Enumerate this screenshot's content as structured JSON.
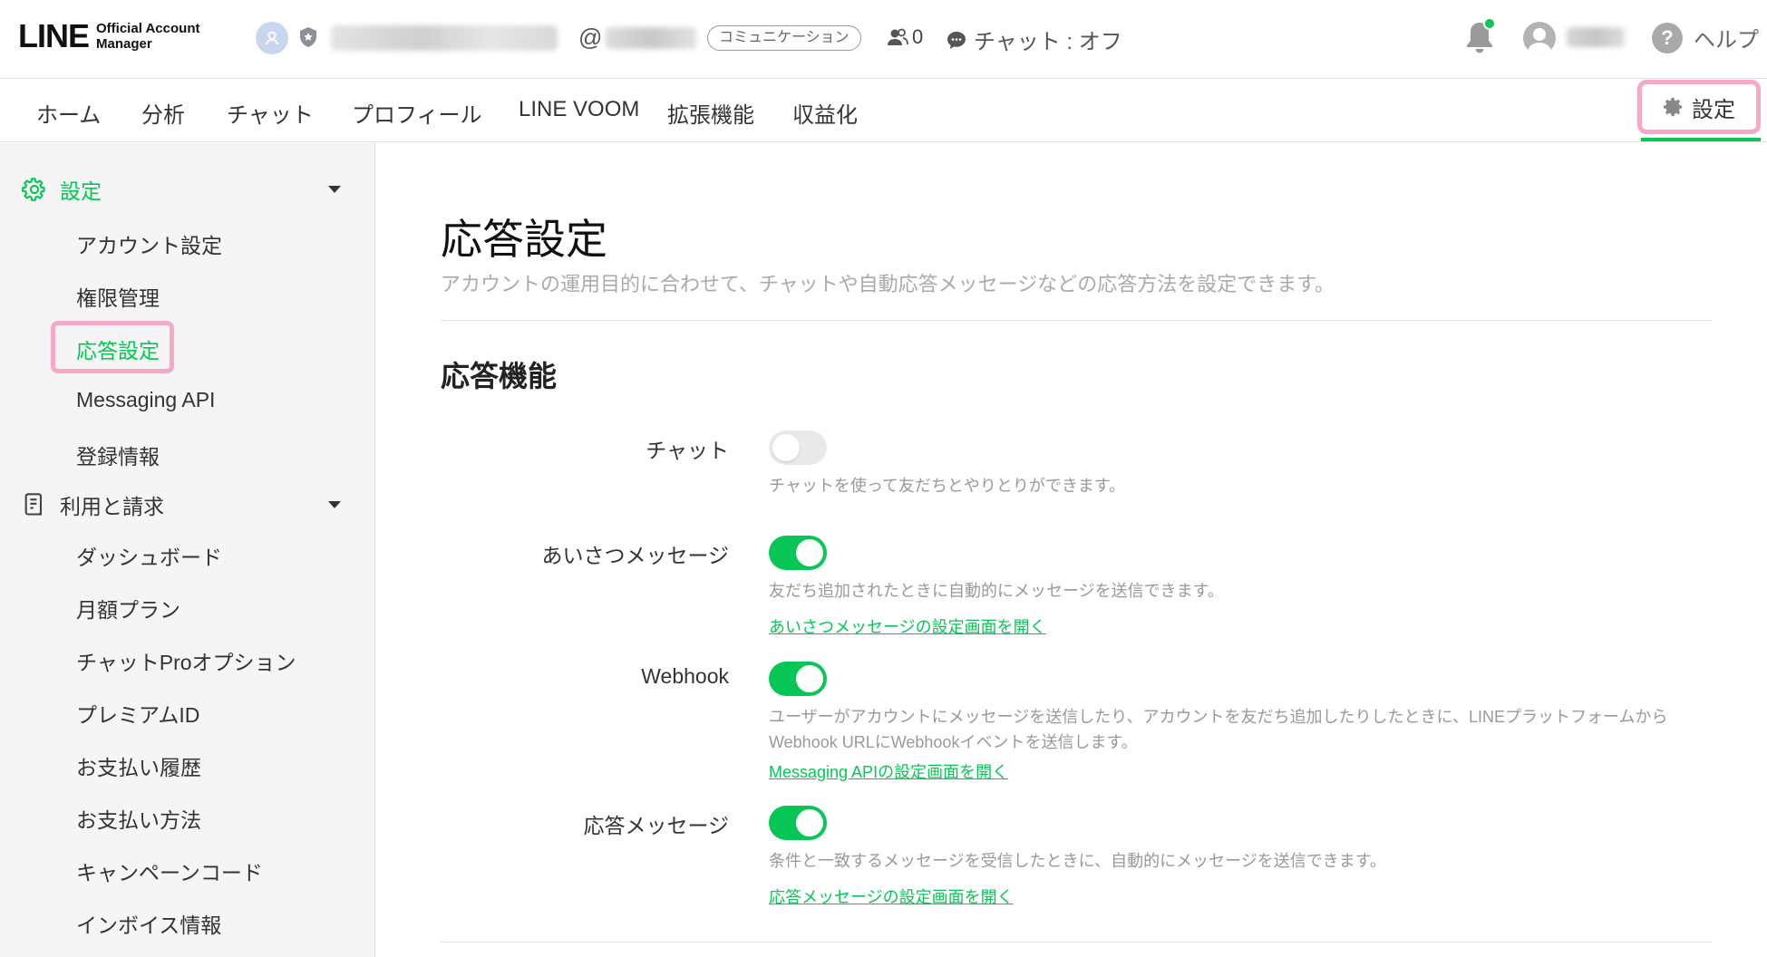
{
  "header": {
    "logo_main": "LINE",
    "logo_sub_1": "Official Account",
    "logo_sub_2": "Manager",
    "at_symbol": "@",
    "plan_badge": "コミュニケーション",
    "friend_count": "0",
    "chat_status": "チャット : オフ",
    "help_label": "ヘルプ",
    "help_icon_char": "?"
  },
  "nav": {
    "items": [
      "ホーム",
      "分析",
      "チャット",
      "プロフィール",
      "LINE VOOM",
      "拡張機能",
      "収益化"
    ],
    "settings_label": "設定",
    "active": "設定"
  },
  "sidebar": {
    "sections": [
      {
        "label": "設定",
        "icon": "gear-icon",
        "expanded": true,
        "items": [
          "アカウント設定",
          "権限管理",
          "応答設定",
          "Messaging API",
          "登録情報"
        ],
        "active_item": "応答設定"
      },
      {
        "label": "利用と請求",
        "icon": "document-icon",
        "expanded": true,
        "items": [
          "ダッシュボード",
          "月額プラン",
          "チャットProオプション",
          "プレミアムID",
          "お支払い履歴",
          "お支払い方法",
          "キャンペーンコード",
          "インボイス情報"
        ]
      }
    ]
  },
  "main": {
    "title": "応答設定",
    "description": "アカウントの運用目的に合わせて、チャットや自動応答メッセージなどの応答方法を設定できます。",
    "section_title": "応答機能",
    "rows": [
      {
        "label": "チャット",
        "enabled": false,
        "description": "チャットを使って友だちとやりとりができます。",
        "description_2": "",
        "link": ""
      },
      {
        "label": "あいさつメッセージ",
        "enabled": true,
        "description": "友だち追加されたときに自動的にメッセージを送信できます。",
        "description_2": "",
        "link": "あいさつメッセージの設定画面を開く"
      },
      {
        "label": "Webhook",
        "enabled": true,
        "description": "ユーザーがアカウントにメッセージを送信したり、アカウントを友だち追加したりしたときに、LINEプラットフォームから",
        "description_2": "Webhook URLにWebhookイベントを送信します。",
        "link": "Messaging APIの設定画面を開く"
      },
      {
        "label": "応答メッセージ",
        "enabled": true,
        "description": "条件と一致するメッセージを受信したときに、自動的にメッセージを送信できます。",
        "description_2": "",
        "link": "応答メッセージの設定画面を開く"
      }
    ]
  },
  "colors": {
    "accent_green": "#06c755",
    "highlight_pink": "#f5a8c8"
  }
}
